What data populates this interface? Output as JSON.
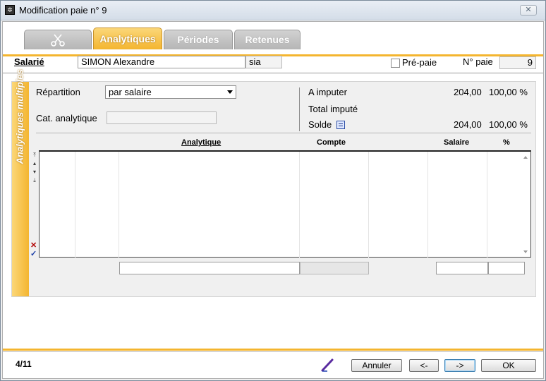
{
  "window": {
    "title": "Modification paie n° 9",
    "close_label": "✕"
  },
  "tabs": [
    {
      "label": "",
      "icon": "scissors-icon"
    },
    {
      "label": "Analytiques"
    },
    {
      "label": "Périodes"
    },
    {
      "label": "Retenues"
    }
  ],
  "header": {
    "salarie_label": "Salarié",
    "salarie_name": "SIMON Alexandre",
    "salarie_code": "sia",
    "prepaie_label": "Pré-paie",
    "numpaie_label": "N° paie",
    "numpaie_value": "9"
  },
  "panel": {
    "vertical_label": "Analytiques multiples",
    "repartition_label": "Répartition",
    "repartition_value": "par salaire",
    "cat_label": "Cat. analytique",
    "cat_value": "",
    "a_imputer_label": "A imputer",
    "a_imputer_amount": "204,00",
    "a_imputer_pct": "100,00 %",
    "total_impute_label": "Total imputé",
    "solde_label": "Solde",
    "solde_amount": "204,00",
    "solde_pct": "100,00 %"
  },
  "table": {
    "columns": [
      "Analytique",
      "Compte",
      "Salaire",
      "%"
    ],
    "rows": []
  },
  "footer": {
    "page": "4/11",
    "cancel_label": "Annuler",
    "prev_label": "<-",
    "next_label": "->",
    "ok_label": "OK"
  }
}
